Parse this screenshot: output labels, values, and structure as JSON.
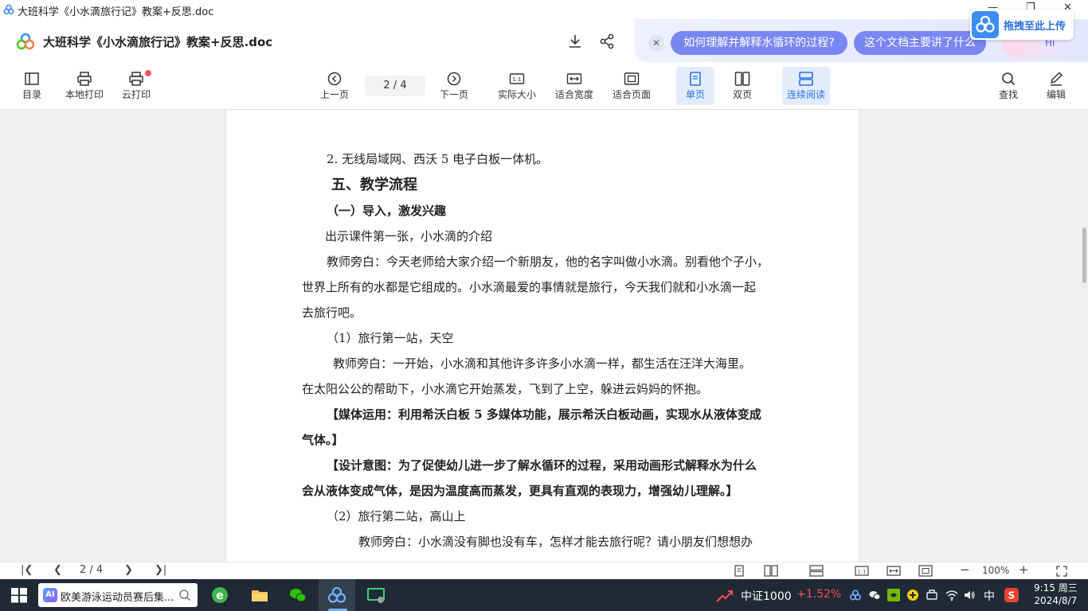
{
  "window": {
    "title": "大班科学《小水滴旅行记》教案+反思.doc",
    "controls": {
      "minimize": "—",
      "restore": "❐",
      "close": "✕"
    }
  },
  "header": {
    "doc_title": "大班科学《小水滴旅行记》教案+反思.doc",
    "ai_chips": [
      "如何理解并解释水循环的过程?",
      "这个文档主要讲了什么"
    ],
    "upload_label": "拖拽至此上传",
    "assistant_label": "Hi"
  },
  "toolbar": {
    "left": [
      {
        "label": "目录",
        "icon": "toc-icon"
      },
      {
        "label": "本地打印",
        "icon": "printer-icon"
      },
      {
        "label": "云打印",
        "icon": "cloud-printer-icon"
      }
    ],
    "prev_label": "上一页",
    "page_value": "2 / 4",
    "next_label": "下一页",
    "view": [
      {
        "label": "实际大小",
        "icon": "actual-size-icon"
      },
      {
        "label": "适合宽度",
        "icon": "fit-width-icon"
      },
      {
        "label": "适合页面",
        "icon": "fit-page-icon"
      },
      {
        "label": "单页",
        "icon": "single-page-icon"
      },
      {
        "label": "双页",
        "icon": "double-page-icon"
      },
      {
        "label": "连续阅读",
        "icon": "continuous-icon"
      }
    ],
    "search_label": "查找",
    "edit_label": "编辑"
  },
  "document": {
    "lines": [
      "2. 无线局域网、西沃 5 电子白板一体机。",
      "五、教学流程",
      "（一）导入，激发兴趣",
      "出示课件第一张，小水滴的介绍",
      "教师旁白：今天老师给大家介绍一个新朋友，他的名字叫做小水滴。别看他个子小，",
      "世界上所有的水都是它组成的。小水滴最爱的事情就是旅行，今天我们就和小水滴一起",
      "去旅行吧。",
      "（1）旅行第一站，天空",
      "教师旁白：一开始，小水滴和其他许多许多小水滴一样，都生活在汪洋大海里。",
      "在太阳公公的帮助下，小水滴它开始蒸发，飞到了上空，躲进云妈妈的怀抱。",
      "【媒体运用：利用希沃白板 5 多媒体功能，展示希沃白板动画，实现水从液体变成",
      "气体。】",
      "【设计意图：为了促使幼儿进一步了解水循环的过程，采用动画形式解释水为什么",
      "会从液体变成气体，是因为温度高而蒸发，更具有直观的表现力，增强幼儿理解。】",
      "（2）旅行第二站，高山上",
      "教师旁白：小水滴没有脚也没有车，怎样才能去旅行呢？请小朋友们想想办"
    ]
  },
  "statusbar": {
    "page_value": "2 / 4",
    "zoom": "100%"
  },
  "taskbar": {
    "search_text": "欧美游泳运动员赛后集...",
    "search_ai_badge": "AI",
    "stock_name": "中证1000",
    "stock_change": "+1.52%",
    "ime": "中",
    "time": "9:15 周三",
    "date": "2024/8/7"
  },
  "colors": {
    "accent": "#2d6fe4",
    "chip_bg": "#7a86f2",
    "stock_up": "#ff4d4f",
    "taskbar_bg": "#1f2a36"
  }
}
